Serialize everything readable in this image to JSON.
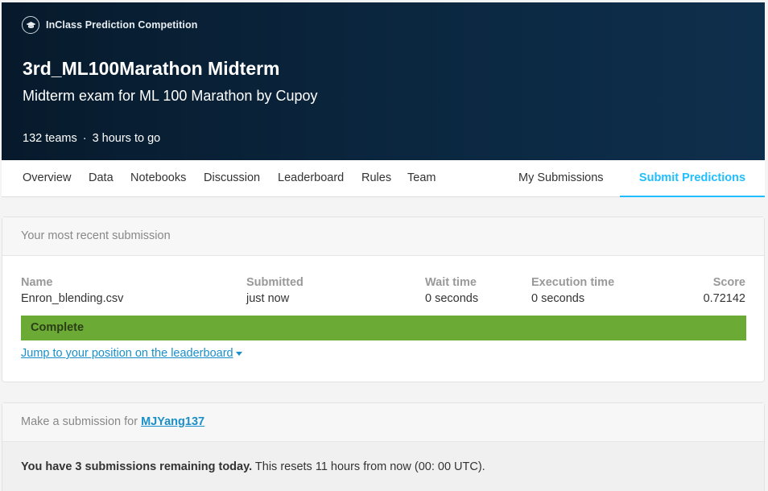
{
  "header": {
    "badge": "InClass Prediction Competition",
    "title": "3rd_ML100Marathon Midterm",
    "subtitle": "Midterm exam for ML 100 Marathon by Cupoy",
    "teams": "132 teams",
    "separator": "·",
    "time_left": "3 hours to go"
  },
  "tabs": {
    "overview": "Overview",
    "data": "Data",
    "notebooks": "Notebooks",
    "discussion": "Discussion",
    "leaderboard": "Leaderboard",
    "rules": "Rules",
    "team": "Team",
    "my_submissions": "My Submissions",
    "submit_predictions": "Submit Predictions"
  },
  "recent": {
    "heading": "Your most recent submission",
    "columns": {
      "name": "Name",
      "submitted": "Submitted",
      "wait": "Wait time",
      "exec": "Execution time",
      "score": "Score"
    },
    "row": {
      "name": "Enron_blending.csv",
      "submitted": "just now",
      "wait": "0 seconds",
      "exec": "0 seconds",
      "score": "0.72142"
    },
    "status": "Complete",
    "jump_link": "Jump to your position on the leaderboard"
  },
  "make_submission": {
    "prefix": "Make a submission for",
    "user": "MJYang137",
    "remaining_bold": "You have 3 submissions remaining today.",
    "remaining_rest": " This resets 11 hours from now (00: 00 UTC)."
  },
  "colors": {
    "header_bg": "#0b2740",
    "accent": "#20beff",
    "status_complete": "#6aaa35",
    "link": "#1a8fc9"
  },
  "icons": {
    "badge": "graduation-cap-icon",
    "dropdown": "caret-down-icon"
  }
}
